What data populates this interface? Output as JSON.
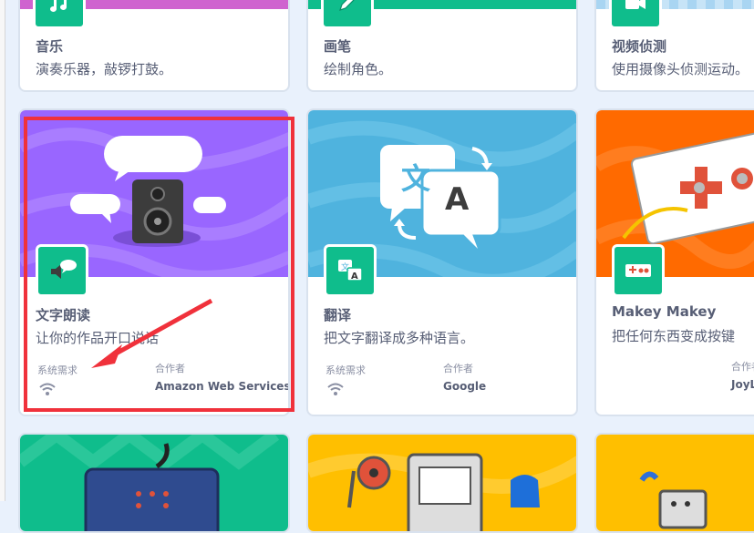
{
  "row1": [
    {
      "title": "音乐",
      "desc": "演奏乐器，敲锣打鼓。",
      "icon": "music-notes-icon"
    },
    {
      "title": "画笔",
      "desc": "绘制角色。",
      "icon": "pen-icon"
    },
    {
      "title": "视频侦测",
      "desc": "使用摄像头侦测运动。",
      "icon": "video-camera-icon"
    }
  ],
  "row2": [
    {
      "title": "文字朗读",
      "desc": "让你的作品开口说话",
      "req_label": "系统需求",
      "collab_label": "合作者",
      "collaborator": "Amazon Web Services",
      "icon": "speaker-speech-icon"
    },
    {
      "title": "翻译",
      "desc": "把文字翻译成多种语言。",
      "req_label": "系统需求",
      "collab_label": "合作者",
      "collaborator": "Google",
      "icon": "translate-icon",
      "hero_glyph_1": "文",
      "hero_glyph_2": "A"
    },
    {
      "title": "Makey Makey",
      "desc": "把任何东西变成按键",
      "collab_label": "合作者",
      "collaborator": "JoyLabz",
      "icon": "makey-makey-icon"
    }
  ],
  "colors": {
    "accent": "#0fbd8c",
    "highlight": "#f0313b",
    "text": "#575e75",
    "speech_purple": "#9966ff",
    "translate_blue": "#4fb3de",
    "makey_orange": "#ff6a00"
  }
}
